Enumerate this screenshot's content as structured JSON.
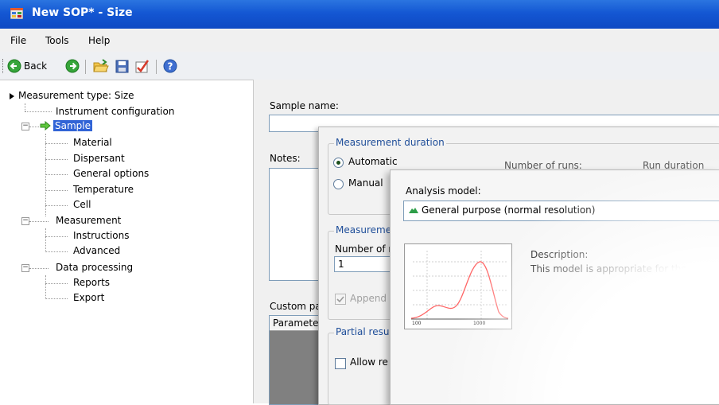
{
  "window": {
    "title": "New SOP* - Size"
  },
  "menu": {
    "file": "File",
    "tools": "Tools",
    "help": "Help"
  },
  "toolbar": {
    "back_label": "Back"
  },
  "tree": {
    "root": "Measurement type: Size",
    "instrument_configuration": "Instrument configuration",
    "sample": "Sample",
    "material": "Material",
    "dispersant": "Dispersant",
    "general_options": "General options",
    "temperature": "Temperature",
    "cell": "Cell",
    "measurement": "Measurement",
    "instructions": "Instructions",
    "advanced": "Advanced",
    "data_processing": "Data processing",
    "reports": "Reports",
    "export": "Export"
  },
  "sample_form": {
    "sample_name_label": "Sample name:",
    "sample_name_value": "",
    "notes_label": "Notes:",
    "custom_params_label": "Custom pa",
    "parameter_header": "Parameter"
  },
  "measurement_panel": {
    "duration_group": "Measurement duration",
    "automatic": "Automatic",
    "manual": "Manual",
    "number_of_runs": "Number of runs:",
    "run_duration": "Run duration (se",
    "measurements_group": "Measureme",
    "number_of_label": "Number of r",
    "number_value": "1",
    "append": "Append",
    "partial_group": "Partial resul",
    "allow": "Allow re"
  },
  "analysis_panel": {
    "model_label": "Analysis model:",
    "model_value": "General purpose (normal resolution)",
    "description_label": "Description:",
    "description_text": "This model is appropriate for the ma",
    "thumb_tick_100": "100",
    "thumb_tick_1000": "1000"
  },
  "colors": {
    "titlebar": "#1457d3",
    "group_title": "#1f4e99",
    "curve": "#ff6666"
  }
}
